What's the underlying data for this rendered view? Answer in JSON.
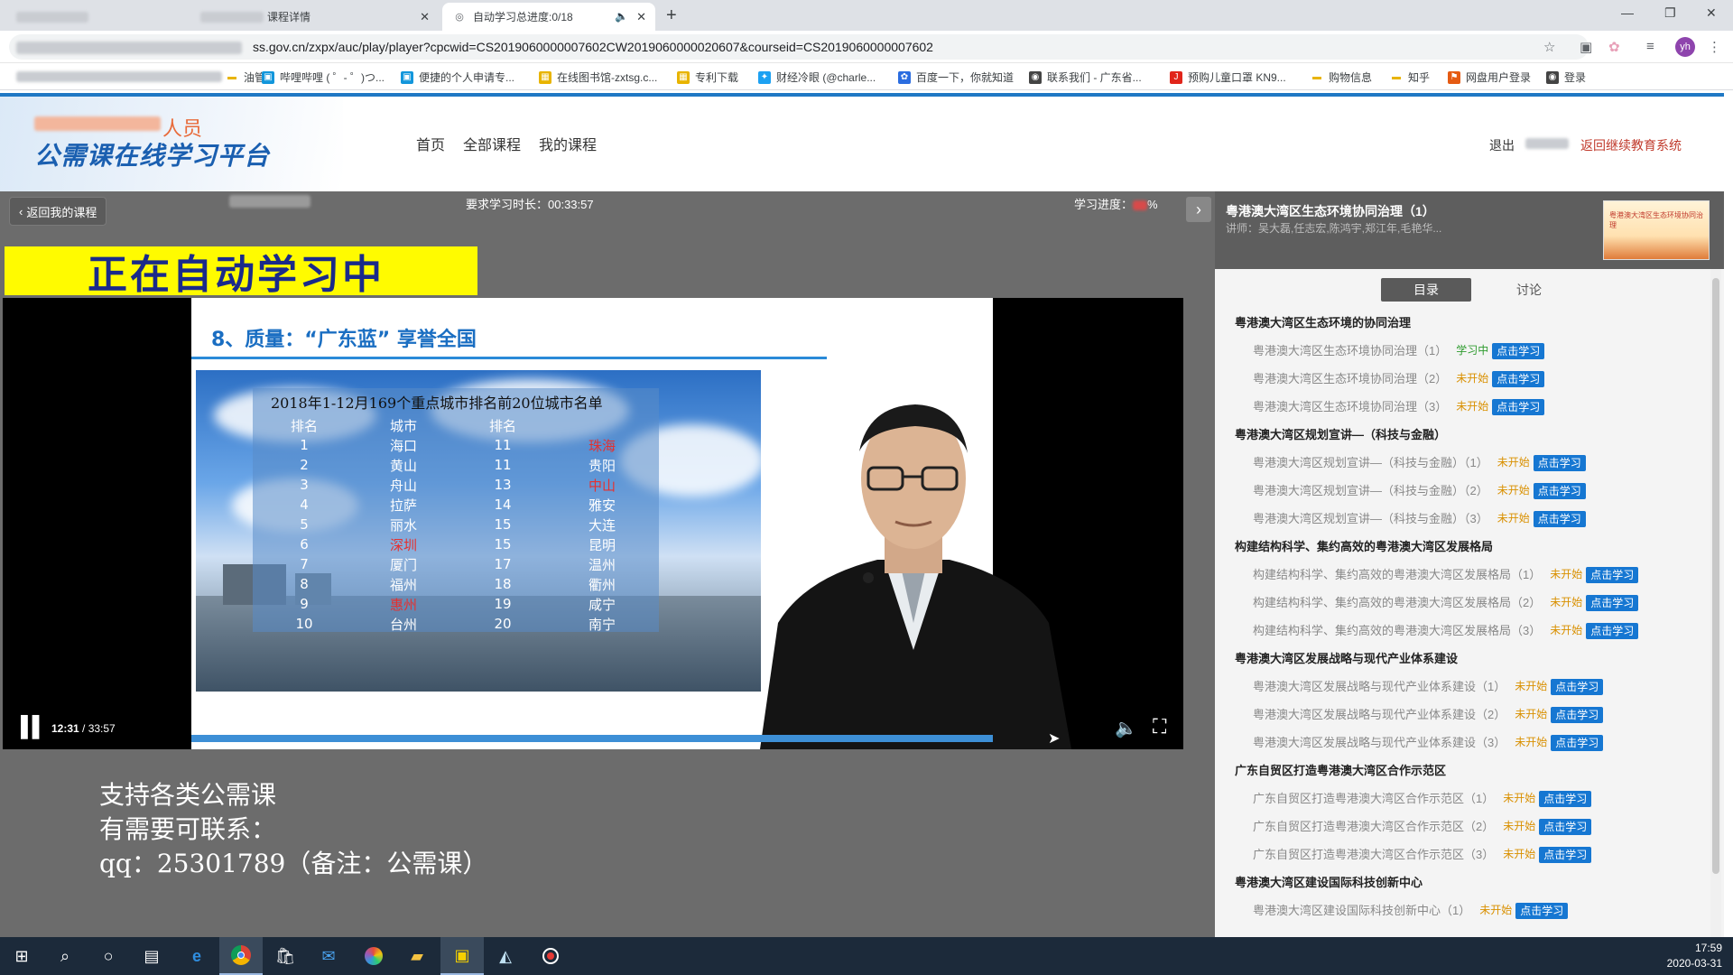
{
  "browser": {
    "tabs": [
      {
        "title": "课程详情",
        "active": false
      },
      {
        "title": "自动学习总进度:0/18",
        "active": true
      }
    ],
    "url": "ss.gov.cn/zxpx/auc/play/player?cpcwid=CS2019060000007602CW2019060000020607&courseid=CS2019060000007602",
    "avatar": "yh",
    "bookmarks": [
      {
        "label": "油管",
        "icon": "folder",
        "color": "#e8b400"
      },
      {
        "label": "哔哩哔哩 ( ゜- ゜)つ...",
        "icon": "bili-icon",
        "color": "#1296db"
      },
      {
        "label": "便捷的个人申请专...",
        "icon": "bili-icon",
        "color": "#1296db"
      },
      {
        "label": "在线图书馆-zxtsg.c...",
        "icon": "grid-icon",
        "color": "#e8b400"
      },
      {
        "label": "专利下载",
        "icon": "grid-icon",
        "color": "#e8b400"
      },
      {
        "label": "财经冷眼 (@charle...",
        "icon": "twitter-icon",
        "color": "#1da1f2"
      },
      {
        "label": "百度一下，你就知道",
        "icon": "paw-icon",
        "color": "#2b6de0"
      },
      {
        "label": "联系我们 - 广东省...",
        "icon": "globe-icon",
        "color": "#444444"
      },
      {
        "label": "预购儿童口罩 KN9...",
        "icon": "jd-icon",
        "color": "#e1251b"
      },
      {
        "label": "购物信息",
        "icon": "folder",
        "color": "#e8b400"
      },
      {
        "label": "知乎",
        "icon": "folder",
        "color": "#e8b400"
      },
      {
        "label": "网盘用户登录",
        "icon": "flag-icon",
        "color": "#e55b13"
      },
      {
        "label": "登录",
        "icon": "globe-icon",
        "color": "#444444"
      }
    ]
  },
  "site": {
    "logo_sub": "人员",
    "logo_main": "公需课在线学习平台",
    "nav": [
      "首页",
      "全部课程",
      "我的课程"
    ],
    "logout": "退出",
    "return_link": "返回继续教育系统"
  },
  "player": {
    "back_label": "返回我的课程",
    "required_time": "要求学习时长：00:33:57",
    "progress_label": "学习进度：",
    "progress_unit": "%",
    "auto_banner": "正在自动学习中",
    "slide_title": "8、质量：“广东蓝” 享誉全国",
    "slide_heading": "2018年1-12月169个重点城市排名前20位城市名单",
    "table_headers": [
      "排名",
      "城市",
      "排名",
      ""
    ],
    "table_rows": [
      {
        "r1": "1",
        "c1": "海口",
        "c1_red": false,
        "r2": "11",
        "c2": "珠海",
        "c2_red": true
      },
      {
        "r1": "2",
        "c1": "黄山",
        "c1_red": false,
        "r2": "11",
        "c2": "贵阳",
        "c2_red": false
      },
      {
        "r1": "3",
        "c1": "舟山",
        "c1_red": false,
        "r2": "13",
        "c2": "中山",
        "c2_red": true
      },
      {
        "r1": "4",
        "c1": "拉萨",
        "c1_red": false,
        "r2": "14",
        "c2": "雅安",
        "c2_red": false
      },
      {
        "r1": "5",
        "c1": "丽水",
        "c1_red": false,
        "r2": "15",
        "c2": "大连",
        "c2_red": false
      },
      {
        "r1": "6",
        "c1": "深圳",
        "c1_red": true,
        "r2": "15",
        "c2": "昆明",
        "c2_red": false
      },
      {
        "r1": "7",
        "c1": "厦门",
        "c1_red": false,
        "r2": "17",
        "c2": "温州",
        "c2_red": false
      },
      {
        "r1": "8",
        "c1": "福州",
        "c1_red": false,
        "r2": "18",
        "c2": "衢州",
        "c2_red": false
      },
      {
        "r1": "9",
        "c1": "惠州",
        "c1_red": true,
        "r2": "19",
        "c2": "咸宁",
        "c2_red": false
      },
      {
        "r1": "10",
        "c1": "台州",
        "c1_red": false,
        "r2": "20",
        "c2": "南宁",
        "c2_red": false
      }
    ],
    "time_current": "12:31",
    "time_total": " / 33:57",
    "support_lines": [
      "支持各类公需课",
      "有需要可联系：",
      "qq：25301789（备注：公需课）"
    ]
  },
  "side": {
    "current_title": "粤港澳大湾区生态环境协同治理（1）",
    "teachers": "讲师：吴大磊,任志宏,陈鸿宇,郑江年,毛艳华...",
    "thumb_text": "粤港澳大湾区生态环境协同治理",
    "tab_catalog": "目录",
    "tab_discussion": "讨论",
    "chapters": [
      {
        "title": "粤港澳大湾区生态环境的协同治理",
        "lessons": [
          {
            "name": "粤港澳大湾区生态环境协同治理（1）",
            "status": "学习中",
            "learning": true
          },
          {
            "name": "粤港澳大湾区生态环境协同治理（2）",
            "status": "未开始",
            "learning": false
          },
          {
            "name": "粤港澳大湾区生态环境协同治理（3）",
            "status": "未开始",
            "learning": false
          }
        ]
      },
      {
        "title": "粤港澳大湾区规划宣讲—（科技与金融）",
        "lessons": [
          {
            "name": "粤港澳大湾区规划宣讲—（科技与金融）（1）",
            "status": "未开始",
            "learning": false
          },
          {
            "name": "粤港澳大湾区规划宣讲—（科技与金融）（2）",
            "status": "未开始",
            "learning": false
          },
          {
            "name": "粤港澳大湾区规划宣讲—（科技与金融）（3）",
            "status": "未开始",
            "learning": false
          }
        ]
      },
      {
        "title": "构建结构科学、集约高效的粤港澳大湾区发展格局",
        "lessons": [
          {
            "name": "构建结构科学、集约高效的粤港澳大湾区发展格局（1）",
            "status": "未开始",
            "learning": false
          },
          {
            "name": "构建结构科学、集约高效的粤港澳大湾区发展格局（2）",
            "status": "未开始",
            "learning": false
          },
          {
            "name": "构建结构科学、集约高效的粤港澳大湾区发展格局（3）",
            "status": "未开始",
            "learning": false
          }
        ]
      },
      {
        "title": "粤港澳大湾区发展战略与现代产业体系建设",
        "lessons": [
          {
            "name": "粤港澳大湾区发展战略与现代产业体系建设（1）",
            "status": "未开始",
            "learning": false
          },
          {
            "name": "粤港澳大湾区发展战略与现代产业体系建设（2）",
            "status": "未开始",
            "learning": false
          },
          {
            "name": "粤港澳大湾区发展战略与现代产业体系建设（3）",
            "status": "未开始",
            "learning": false
          }
        ]
      },
      {
        "title": "广东自贸区打造粤港澳大湾区合作示范区",
        "lessons": [
          {
            "name": "广东自贸区打造粤港澳大湾区合作示范区（1）",
            "status": "未开始",
            "learning": false
          },
          {
            "name": "广东自贸区打造粤港澳大湾区合作示范区（2）",
            "status": "未开始",
            "learning": false
          },
          {
            "name": "广东自贸区打造粤港澳大湾区合作示范区（3）",
            "status": "未开始",
            "learning": false
          }
        ]
      },
      {
        "title": "粤港澳大湾区建设国际科技创新中心",
        "lessons": [
          {
            "name": "粤港澳大湾区建设国际科技创新中心（1）",
            "status": "未开始",
            "learning": false
          }
        ]
      }
    ],
    "go_label": "点击学习"
  },
  "taskbar": {
    "time": "17:59",
    "date": "2020-03-31"
  }
}
